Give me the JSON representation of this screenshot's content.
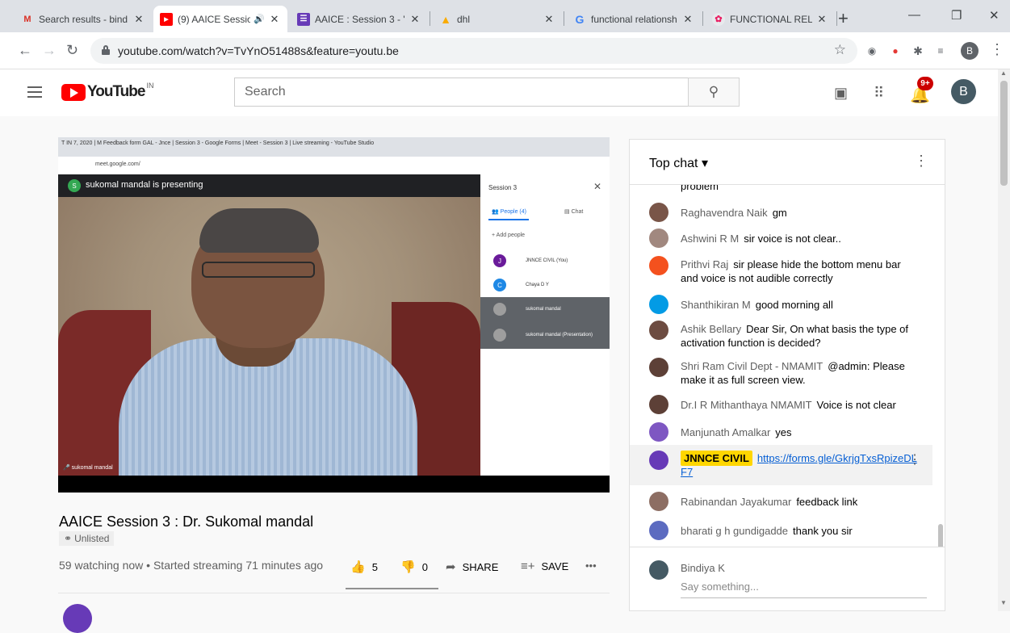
{
  "browser": {
    "tabs": [
      {
        "title": "Search results - bind",
        "icon": "gmail-icon",
        "active": false
      },
      {
        "title": "(9) AAICE Session",
        "icon": "youtube-icon",
        "active": true,
        "audio": "speaker-icon"
      },
      {
        "title": "AAICE : Session 3 - \"/",
        "icon": "forms-icon",
        "active": false
      },
      {
        "title": "dhl",
        "icon": "drive-icon",
        "active": false
      },
      {
        "title": "functional relationsh",
        "icon": "google-icon",
        "active": false
      },
      {
        "title": "FUNCTIONAL RELAT",
        "icon": "site-icon",
        "active": false
      }
    ],
    "url": "youtube.com/watch?v=TvYnO51488s&feature=youtu.be",
    "profile_initial": "B"
  },
  "youtube": {
    "logo_word": "YouTube",
    "country": "IN",
    "search_placeholder": "Search",
    "notifications": "9+",
    "avatar_initial": "B"
  },
  "video": {
    "inner_tabs": "T  IN 7, 2020 | M Feedback form GAL - Jnce | Session 3 - Google Forms | Meet - Session 3 | Live streaming - YouTube Studio",
    "inner_url": "meet.google.com/",
    "presenting_text": "sukomal mandal is presenting",
    "presenting_initial": "S",
    "name_tag": "sukomal mandal",
    "meet_panel": {
      "header": "Session 3",
      "people_tab": "People (4)",
      "chat_tab": "Chat",
      "add_people": "Add people",
      "people": [
        {
          "name": "JNNCE CIVIL (You)",
          "initial": "J",
          "color": "#6a1b9a"
        },
        {
          "name": "Chaya D Y",
          "initial": "C",
          "color": "#1e88e5"
        },
        {
          "name": "sukomal mandal",
          "initial": "",
          "color": "#9e9e9e"
        },
        {
          "name": "sukomal mandal (Presentation)",
          "initial": "",
          "color": "#9e9e9e"
        }
      ]
    },
    "title": "AAICE Session 3 : Dr. Sukomal mandal",
    "unlisted_label": "Unlisted",
    "meta": "59 watching now • Started streaming 71 minutes ago",
    "likes": "5",
    "dislikes": "0",
    "share_label": "SHARE",
    "save_label": "SAVE"
  },
  "chat": {
    "header": "Top chat",
    "partial_text": "problem",
    "messages": [
      {
        "author": "Raghavendra Naik",
        "text": "gm",
        "color": "#795548"
      },
      {
        "author": "Ashwini R M",
        "text": "sir voice is not clear..",
        "color": "#a1887f"
      },
      {
        "author": "Prithvi Raj",
        "text": "sir please hide the bottom menu bar and voice is not audible correctly",
        "color": "#f4511e"
      },
      {
        "author": "Shanthikiran M",
        "text": "good morning all",
        "color": "#039be5"
      },
      {
        "author": "Ashik Bellary",
        "text": "Dear Sir, On what basis the type of activation function is decided?",
        "color": "#6d4c41"
      },
      {
        "author": "Shri Ram Civil Dept - NMAMIT",
        "text": "@admin: Please make it as full screen view.",
        "color": "#5d4037"
      },
      {
        "author": "Dr.I R Mithanthaya NMAMIT",
        "text": "Voice is not clear",
        "color": "#5d4037"
      },
      {
        "author": "Manjunath Amalkar",
        "text": "yes",
        "color": "#7e57c2"
      },
      {
        "author": "JNNCE CIVIL",
        "text": "https://forms.gle/GkrjgTxsRpizeDLF7",
        "color": "#673ab7"
      },
      {
        "author": "Rabinandan Jayakumar",
        "text": "feedback link",
        "color": "#8d6e63"
      },
      {
        "author": "bharati g h gundigadde",
        "text": "thank you sir",
        "color": "#5c6bc0"
      }
    ],
    "input_name": "Bindiya K",
    "input_placeholder": "Say something..."
  }
}
